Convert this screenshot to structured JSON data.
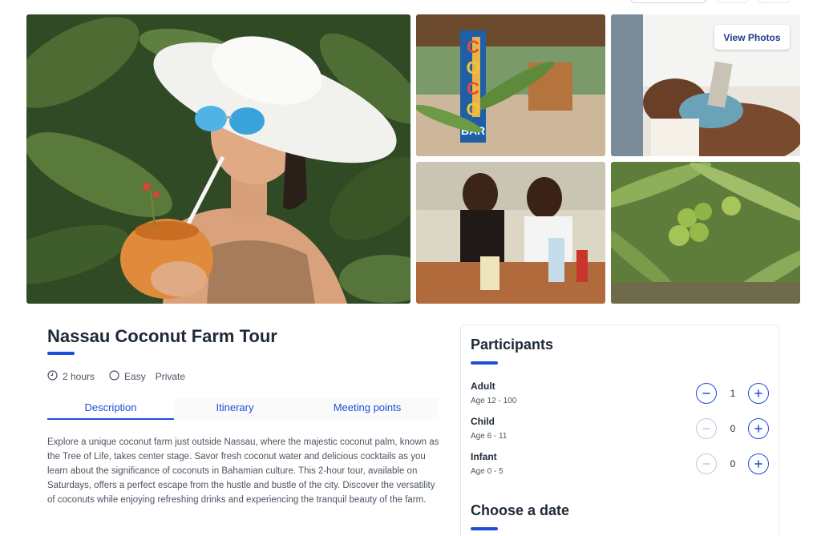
{
  "gallery": {
    "view_photos_label": "View Photos",
    "images": [
      {
        "name": "woman-with-coconut-photo"
      },
      {
        "name": "coco-bar-photo",
        "sign": "COCO",
        "sign_bar": "BAR"
      },
      {
        "name": "hands-grating-coconut-photo"
      },
      {
        "name": "women-at-table-photo"
      },
      {
        "name": "coconut-trees-photo"
      }
    ]
  },
  "tour": {
    "title": "Nassau Coconut Farm Tour",
    "duration": "2 hours",
    "difficulty": "Easy",
    "type": "Private"
  },
  "tabs": [
    "Description",
    "Itinerary",
    "Meeting points"
  ],
  "description": "Explore a unique coconut farm just outside Nassau, where the majestic coconut palm, known as the Tree of Life, takes center stage. Savor fresh coconut water and delicious cocktails as you learn about the significance of coconuts in Bahamian culture. This 2-hour tour, available on Saturdays, offers a perfect escape from the hustle and bustle of the city. Discover the versatility of coconuts while enjoying refreshing drinks and experiencing the tranquil beauty of the farm.",
  "participants": {
    "title": "Participants",
    "rows": [
      {
        "label": "Adult",
        "age": "Age 12 - 100",
        "count": "1"
      },
      {
        "label": "Child",
        "age": "Age 6 - 11",
        "count": "0"
      },
      {
        "label": "Infant",
        "age": "Age 0 - 5",
        "count": "0"
      }
    ]
  },
  "date": {
    "title": "Choose a date"
  },
  "colors": {
    "accent": "#1d4ed8",
    "title": "#1f2937",
    "text": "#4b5563"
  }
}
